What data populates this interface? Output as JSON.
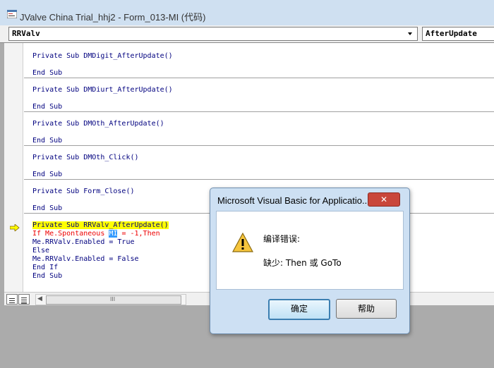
{
  "window": {
    "title": "JValve China Trial_hhj2 - Form_013-MI (代码)"
  },
  "combos": {
    "object": "RRValv",
    "procedure": "AfterUpdate"
  },
  "code": {
    "blocks": [
      {
        "sub": "Private Sub DMDigit_AfterUpdate()",
        "end": "End Sub"
      },
      {
        "sub": "Private Sub DMDiurt_AfterUpdate()",
        "end": "End Sub"
      },
      {
        "sub": "Private Sub DMOth_AfterUpdate()",
        "end": "End Sub"
      },
      {
        "sub": "Private Sub DMOth_Click()",
        "end": "End Sub"
      },
      {
        "sub": "Private Sub Form_Close()",
        "end": "End Sub"
      }
    ],
    "active": {
      "sub": "Private Sub RRValv_AfterUpdate()",
      "if_prefix": "If Me.Spontaneous ",
      "if_selected": "MI",
      "if_suffix": " = -1,Then",
      "line3": "Me.RRValv.Enabled = True",
      "line4": "Else",
      "line5": "Me.RRValv.Enabled = False",
      "line6": "End If",
      "line7": "End Sub"
    }
  },
  "statusbar": {
    "scroll_grip": "III"
  },
  "dialog": {
    "title": "Microsoft Visual Basic for Applicatio...",
    "close_glyph": "✕",
    "heading": "编译错误:",
    "message": "缺少: Then 或 GoTo",
    "ok_label": "确定",
    "help_label": "帮助"
  },
  "colors": {
    "highlight": "#ffff00",
    "error_text": "#ee0000",
    "code_text": "#00007f",
    "selection": "#3399ff"
  }
}
